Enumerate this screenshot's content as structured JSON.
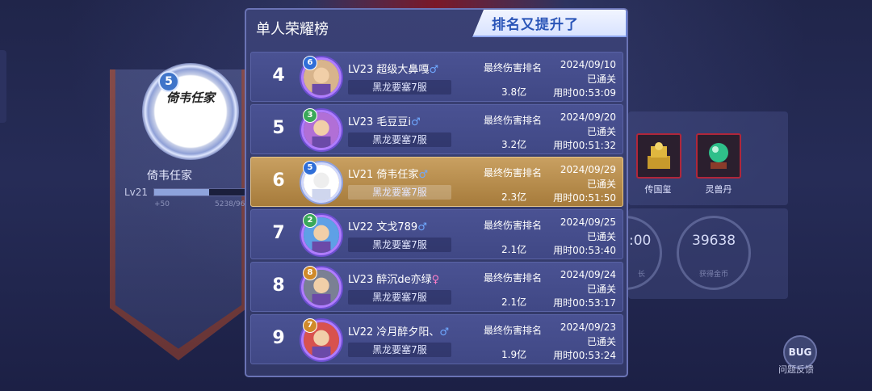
{
  "background": {
    "player_name": "倚韦任家",
    "level": "Lv21",
    "exp_gain": "+50",
    "exp_value": "5238/96",
    "badge_level": "5",
    "logo_text": "倚韦任家",
    "level_progress": 0.6,
    "items": [
      {
        "label": "传国玺",
        "icon": "seal-chest-icon"
      },
      {
        "label": "灵兽丹",
        "icon": "crystal-ball-icon"
      }
    ],
    "stats": [
      {
        "value": ":00",
        "label": "长"
      },
      {
        "value": "39638",
        "label": "获得金币"
      }
    ]
  },
  "bug_button": {
    "label": "BUG",
    "caption": "问题反馈"
  },
  "modal": {
    "title": "单人荣耀榜",
    "tag": "排名又提升了",
    "rank_label": "最终伤害排名",
    "rows": [
      {
        "rank": "4",
        "level": "LV23",
        "name": "超级大鼻嘎",
        "gender": "♂",
        "gender_color": "#6fa8ff",
        "badge": "6",
        "server": "黑龙要塞7服",
        "damage": "3.8亿",
        "date": "2024/09/10",
        "status": "已通关",
        "time": "用时00:53:09",
        "active": false
      },
      {
        "rank": "5",
        "level": "LV23",
        "name": "毛豆豆i",
        "gender": "♂",
        "gender_color": "#6fa8ff",
        "badge": "3",
        "server": "黑龙要塞7服",
        "damage": "3.2亿",
        "date": "2024/09/20",
        "status": "已通关",
        "time": "用时00:51:32",
        "active": false
      },
      {
        "rank": "6",
        "level": "LV21",
        "name": "倚韦任家",
        "gender": "♂",
        "gender_color": "#6fa8ff",
        "badge": "5",
        "server": "黑龙要塞7服",
        "damage": "2.3亿",
        "date": "2024/09/29",
        "status": "已通关",
        "time": "用时00:51:50",
        "active": true
      },
      {
        "rank": "7",
        "level": "LV22",
        "name": "文戈789",
        "gender": "♂",
        "gender_color": "#6fa8ff",
        "badge": "2",
        "server": "黑龙要塞7服",
        "damage": "2.1亿",
        "date": "2024/09/25",
        "status": "已通关",
        "time": "用时00:53:40",
        "active": false
      },
      {
        "rank": "8",
        "level": "LV23",
        "name": "醉沉de亦绿",
        "gender": "♀",
        "gender_color": "#ff7fc8",
        "badge": "8",
        "server": "黑龙要塞7服",
        "damage": "2.1亿",
        "date": "2024/09/24",
        "status": "已通关",
        "time": "用时00:53:17",
        "active": false
      },
      {
        "rank": "9",
        "level": "LV22",
        "name": "冷月醉夕阳、",
        "gender": "♂",
        "gender_color": "#6fa8ff",
        "badge": "7",
        "server": "黑龙要塞7服",
        "damage": "1.9亿",
        "date": "2024/09/23",
        "status": "已通关",
        "time": "用时00:53:24",
        "active": false
      }
    ]
  }
}
